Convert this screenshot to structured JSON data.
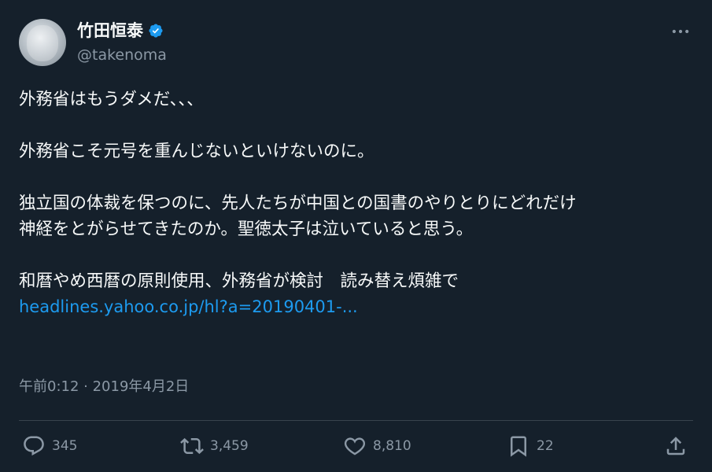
{
  "author": {
    "display_name": "竹田恒泰",
    "handle": "@takenoma",
    "verified": true
  },
  "tweet": {
    "lines": [
      "外務省はもうダメだ、、、",
      "",
      "外務省こそ元号を重んじないといけないのに。",
      "",
      "独立国の体裁を保つのに、先人たちが中国との国書のやりとりにどれだけ",
      "神経をとがらせてきたのか。聖徳太子は泣いていると思う。",
      "",
      "和暦やめ西暦の原則使用、外務省が検討　読み替え煩雑で"
    ],
    "link_text": "headlines.yahoo.co.jp/hl?a=20190401-...",
    "timestamp": "午前0:12 · 2019年4月2日"
  },
  "actions": {
    "replies": "345",
    "retweets": "3,459",
    "likes": "8,810",
    "bookmarks": "22"
  },
  "icons": {
    "verified": "verified-badge-icon",
    "more": "more-options-icon",
    "reply": "reply-icon",
    "retweet": "retweet-icon",
    "like": "heart-icon",
    "bookmark": "bookmark-icon",
    "share": "share-icon"
  },
  "colors": {
    "background": "#15202b",
    "text": "#f7f9f9",
    "secondary": "#8b98a5",
    "accent": "#1d9bf0"
  }
}
